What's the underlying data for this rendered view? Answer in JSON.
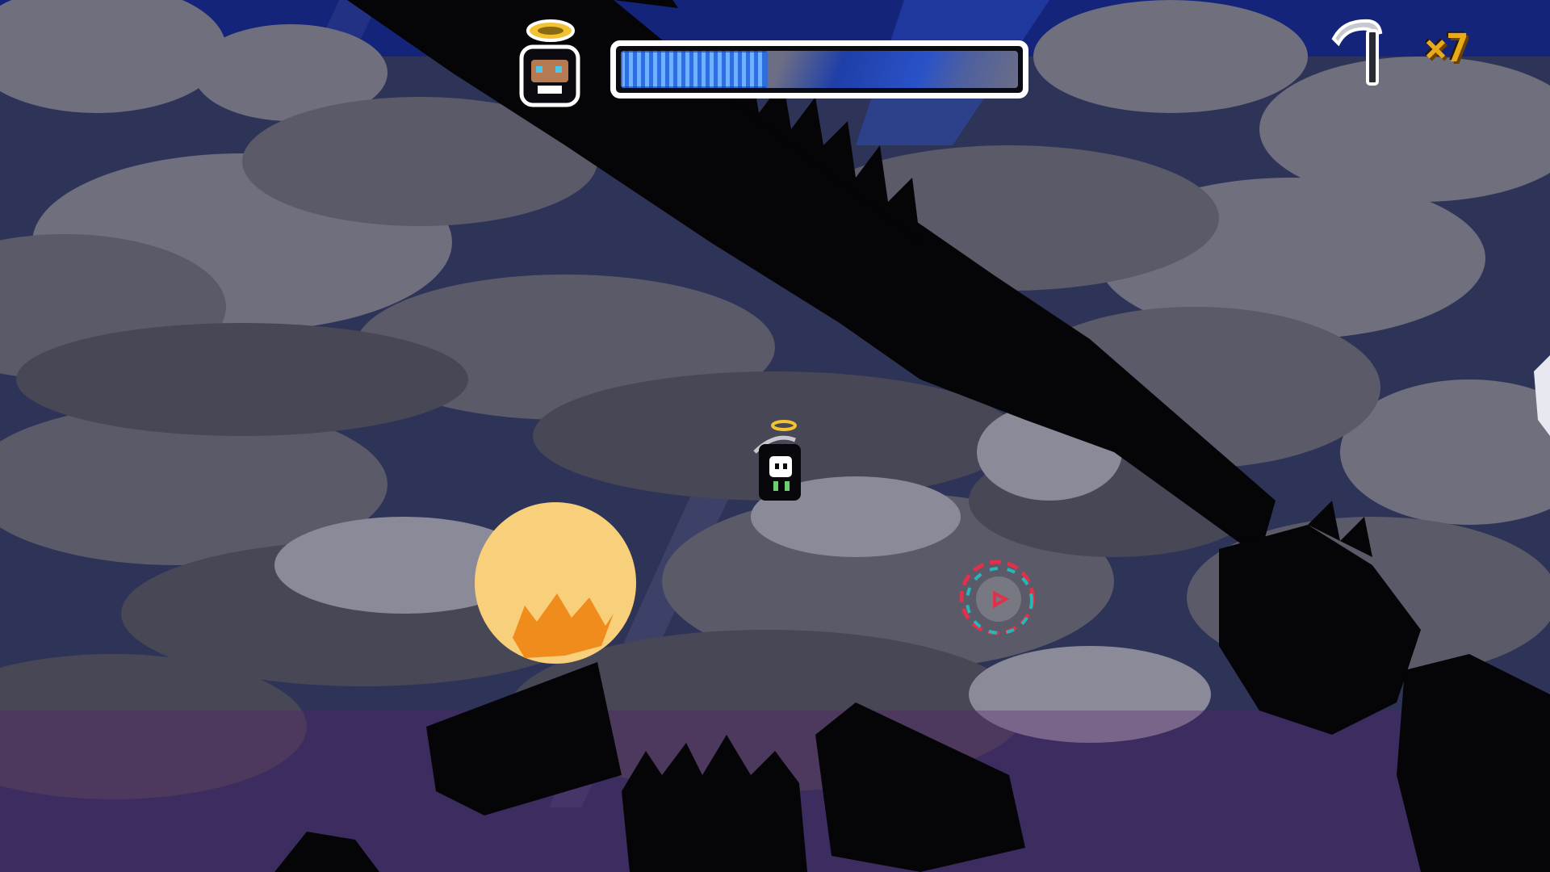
{
  "hud": {
    "player_health_fraction": 0.37,
    "weapon_icon": "scythe-icon",
    "ammo_count": "×7"
  },
  "colors": {
    "sky_top": "#14247a",
    "cloud_dark": "#3c3c48",
    "cloud_light": "#777786",
    "silhouette": "#050507",
    "moon": "#f8cf7a",
    "moon_fire": "#f08c1c",
    "health_fill": "#6fb0ff",
    "ammo_text": "#e8a91a",
    "target_ring_teal": "#26b8b8",
    "target_ring_red": "#e0304a"
  }
}
